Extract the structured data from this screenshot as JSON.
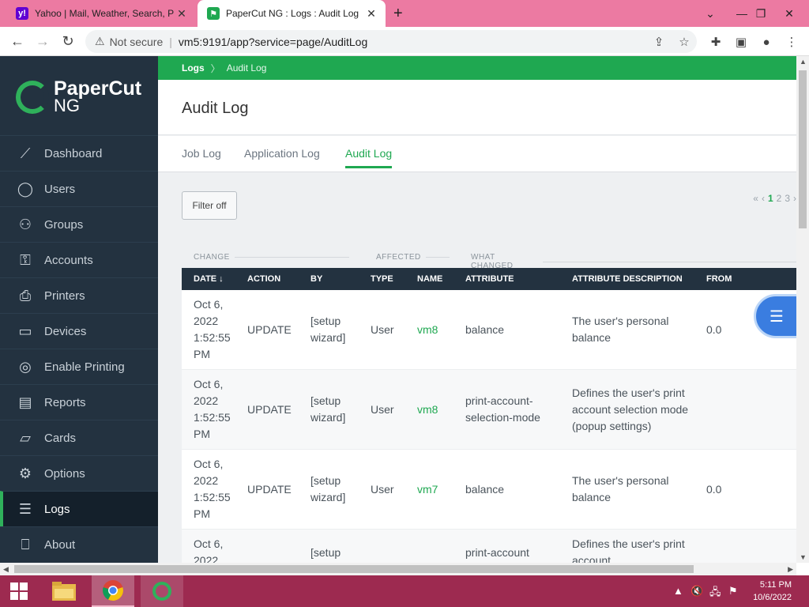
{
  "browser": {
    "tabs": [
      {
        "title": "Yahoo | Mail, Weather, Search, Politics, News, Finance",
        "favicon": "yahoo-icon"
      },
      {
        "title": "PaperCut NG : Logs : Audit Log",
        "favicon": "papercut-icon"
      }
    ],
    "security_label": "Not secure",
    "url": "vm5:9191/app?service=page/AuditLog"
  },
  "sidebar": {
    "logo_line1": "PaperCut",
    "logo_line2": "NG",
    "items": [
      {
        "label": "Dashboard",
        "icon": "chart-line-icon"
      },
      {
        "label": "Users",
        "icon": "user-icon"
      },
      {
        "label": "Groups",
        "icon": "users-icon"
      },
      {
        "label": "Accounts",
        "icon": "key-icon"
      },
      {
        "label": "Printers",
        "icon": "printer-icon"
      },
      {
        "label": "Devices",
        "icon": "device-icon"
      },
      {
        "label": "Enable Printing",
        "icon": "target-icon"
      },
      {
        "label": "Reports",
        "icon": "clipboard-icon"
      },
      {
        "label": "Cards",
        "icon": "cards-icon"
      },
      {
        "label": "Options",
        "icon": "gear-icon"
      },
      {
        "label": "Logs",
        "icon": "list-icon"
      },
      {
        "label": "About",
        "icon": "book-icon"
      }
    ],
    "active": "Logs"
  },
  "breadcrumb": {
    "parent": "Logs",
    "current": "Audit Log"
  },
  "page_title": "Audit Log",
  "tabs": [
    {
      "label": "Job Log"
    },
    {
      "label": "Application Log"
    },
    {
      "label": "Audit Log"
    }
  ],
  "filter_button": "Filter off",
  "pager": {
    "first": "«",
    "prev": "‹",
    "pages": [
      "1",
      "2",
      "3"
    ],
    "next": "›"
  },
  "group_headers": {
    "change": "CHANGE",
    "affected": "AFFECTED",
    "what_changed": "WHAT CHANGED"
  },
  "columns": [
    "DATE ↓",
    "ACTION",
    "BY",
    "TYPE",
    "NAME",
    "ATTRIBUTE",
    "ATTRIBUTE DESCRIPTION",
    "FROM"
  ],
  "rows": [
    {
      "date": "Oct 6, 2022 1:52:55 PM",
      "action": "UPDATE",
      "by": "[setup wizard]",
      "type": "User",
      "name": "vm8",
      "attribute": "balance",
      "description": "The user's personal balance",
      "from": "0.0"
    },
    {
      "date": "Oct 6, 2022 1:52:55 PM",
      "action": "UPDATE",
      "by": "[setup wizard]",
      "type": "User",
      "name": "vm8",
      "attribute": "print-account-selection-mode",
      "description": "Defines the user's print account selection mode (popup settings)",
      "from": ""
    },
    {
      "date": "Oct 6, 2022 1:52:55 PM",
      "action": "UPDATE",
      "by": "[setup wizard]",
      "type": "User",
      "name": "vm7",
      "attribute": "balance",
      "description": "The user's personal balance",
      "from": "0.0"
    },
    {
      "date": "Oct 6, 2022",
      "action": "",
      "by": "[setup",
      "type": "",
      "name": "",
      "attribute": "print-account",
      "description": "Defines the user's print account",
      "from": ""
    }
  ],
  "taskbar": {
    "time": "5:11 PM",
    "date": "10/6/2022"
  }
}
